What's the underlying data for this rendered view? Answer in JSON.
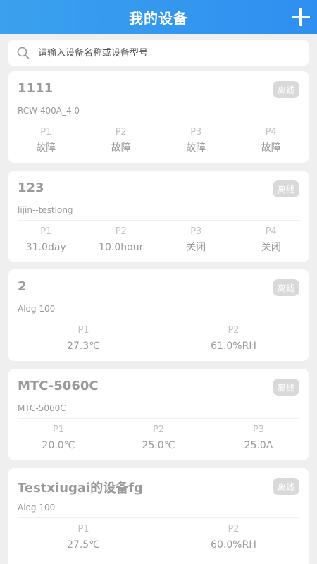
{
  "header": {
    "title": "我的设备",
    "add_icon": "plus-icon"
  },
  "search": {
    "placeholder": "请输入设备名称或设备型号",
    "icon": "search-icon"
  },
  "devices": [
    {
      "name": "1111",
      "model": "RCW-400A_4.0",
      "status": "离线",
      "params": [
        {
          "label": "P1",
          "value": "故障"
        },
        {
          "label": "P2",
          "value": "故障"
        },
        {
          "label": "P3",
          "value": "故障"
        },
        {
          "label": "P4",
          "value": "故障"
        }
      ]
    },
    {
      "name": "123",
      "model": "lijin--testlong",
      "status": "离线",
      "params": [
        {
          "label": "P1",
          "value": "31.0day"
        },
        {
          "label": "P2",
          "value": "10.0hour"
        },
        {
          "label": "P3",
          "value": "关闭"
        },
        {
          "label": "P4",
          "value": "关闭"
        }
      ]
    },
    {
      "name": "2",
      "model": "Alog 100",
      "status": "离线",
      "params": [
        {
          "label": "P1",
          "value": "27.3℃"
        },
        {
          "label": "P2",
          "value": "61.0%RH"
        }
      ]
    },
    {
      "name": "MTC-5060C",
      "model": "MTC-5060C",
      "status": "离线",
      "params": [
        {
          "label": "P1",
          "value": "20.0℃"
        },
        {
          "label": "P2",
          "value": "25.0℃"
        },
        {
          "label": "P3",
          "value": "25.0A"
        }
      ]
    },
    {
      "name": "Testxiugai的设备fg",
      "model": "Alog 100",
      "status": "离线",
      "params": [
        {
          "label": "P1",
          "value": "27.5℃"
        },
        {
          "label": "P2",
          "value": "60.0%RH"
        }
      ]
    }
  ],
  "colors": {
    "header": "#3aa1ee",
    "background": "#efefef",
    "badge": "#d9d9d9"
  }
}
